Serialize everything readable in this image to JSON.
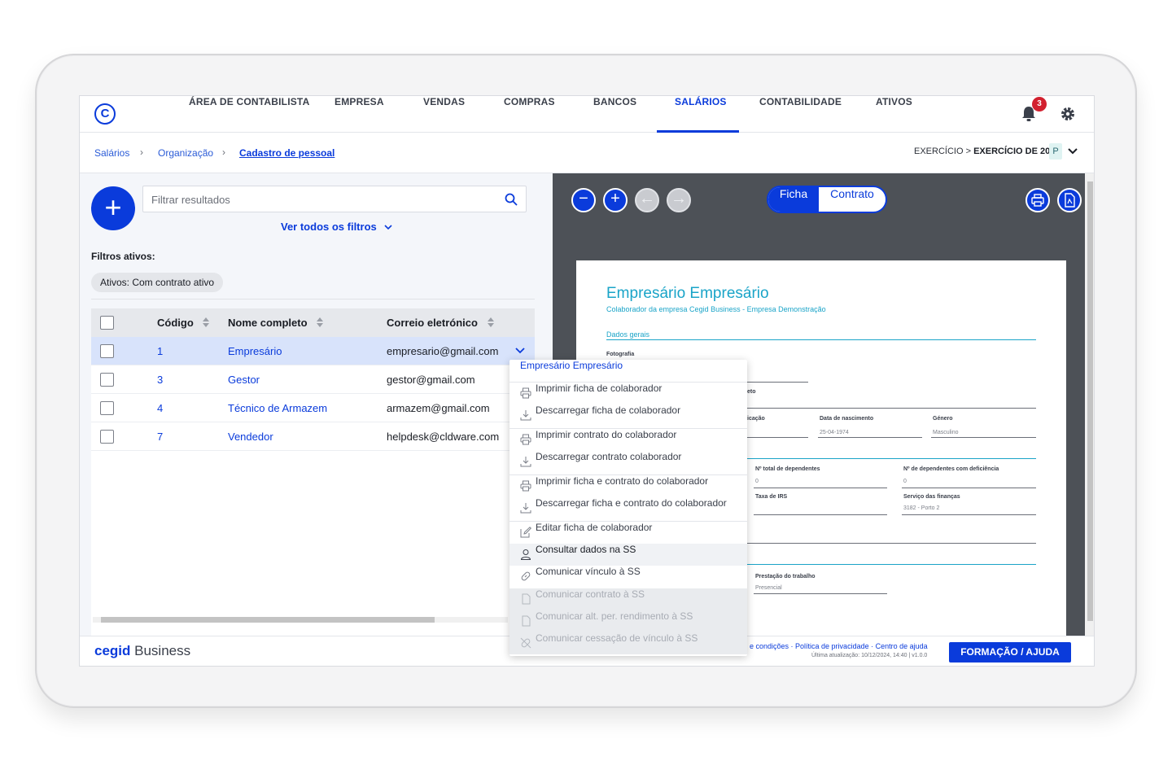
{
  "nav": {
    "items": [
      "ÁREA DE CONTABILISTA",
      "EMPRESA",
      "VENDAS",
      "COMPRAS",
      "BANCOS",
      "SALÁRIOS",
      "CONTABILIDADE",
      "ATIVOS"
    ],
    "active": "SALÁRIOS",
    "notifications": "3",
    "accent": "#0a3bdb"
  },
  "breadcrumb": {
    "items": [
      "Salários",
      "Organização",
      "Cadastro de pessoal"
    ],
    "exercicio_prefix": "EXERCÍCIO >",
    "exercicio_value": "EXERCÍCIO DE 2024",
    "badge": "P"
  },
  "left": {
    "search_placeholder": "Filtrar resultados",
    "ver_filtros": "Ver todos os filtros",
    "filtros_ativos": "Filtros ativos:",
    "chip": "Ativos: Com contrato ativo",
    "columns": [
      "Código",
      "Nome completo",
      "Correio eletrónico"
    ],
    "rows": [
      {
        "codigo": "1",
        "nome": "Empresário",
        "email": "empresario@gmail.com"
      },
      {
        "codigo": "3",
        "nome": "Gestor",
        "email": "gestor@gmail.com"
      },
      {
        "codigo": "4",
        "nome": "Técnico de Armazem",
        "email": "armazem@gmail.com"
      },
      {
        "codigo": "7",
        "nome": "Vendedor",
        "email": "helpdesk@cldware.com"
      }
    ]
  },
  "right": {
    "toggle_ficha": "Ficha",
    "toggle_contrato": "Contrato",
    "doc": {
      "title": "Empresário Empresário",
      "subtitle": "Colaborador da empresa Cegid Business - Empresa Demonstração",
      "section": "Dados gerais",
      "fotografia": "Fotografia",
      "eto": "eto",
      "icacao": "icação",
      "data_nasc_label": "Data de nascimento",
      "data_nasc_value": "25-04-1974",
      "genero_label": "Género",
      "genero_value": "Masculino",
      "dep_label": "Nº total de dependentes",
      "dep_value": "0",
      "dep_def_label": "Nº de dependentes com deficiência",
      "dep_def_value": "0",
      "irs_label": "Taxa de IRS",
      "financas_label": "Serviço das finanças",
      "financas_value": "3182 - Porto 2",
      "prestacao_label": "Prestação do trabalho",
      "prestacao_value": "Presencial"
    }
  },
  "menu": {
    "header": "Empresário Empresário",
    "groups": [
      [
        "Imprimir ficha de colaborador",
        "Descarregar ficha de colaborador"
      ],
      [
        "Imprimir contrato do colaborador",
        "Descarregar contrato colaborador"
      ],
      [
        "Imprimir ficha e contrato do colaborador",
        "Descarregar ficha e contrato do colaborador"
      ],
      [
        "Editar ficha de colaborador",
        "Consultar dados na SS",
        "Comunicar vínculo à SS",
        "Comunicar contrato à SS",
        "Comunicar alt. per. rendimento à SS",
        "Comunicar cessação de vínculo à SS"
      ]
    ]
  },
  "footer": {
    "brand": "cegid",
    "brand_suffix": " Business",
    "links": "e condições · Política de privacidade · Centro de ajuda",
    "update": "Última atualização: 10/12/2024, 14:40 | v1.0.0",
    "button": "FORMAÇÃO / AJUDA"
  }
}
